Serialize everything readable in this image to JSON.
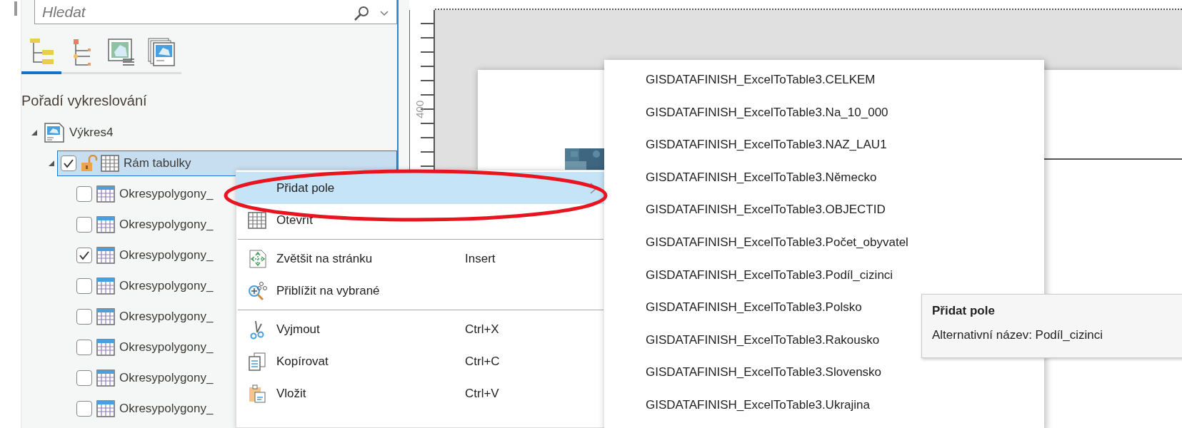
{
  "search": {
    "placeholder": "Hledat"
  },
  "view_tabs": [
    {
      "kind": "order",
      "selected": true
    },
    {
      "kind": "selection",
      "selected": false
    },
    {
      "kind": "map",
      "selected": false
    },
    {
      "kind": "maps",
      "selected": false
    }
  ],
  "heading": "Pořadí vykreslování",
  "tree": [
    {
      "label": "Výkres4",
      "kind": "layout",
      "expanded": true,
      "selected": false,
      "children": [
        {
          "label": "Rám tabulky",
          "kind": "frame",
          "expanded": true,
          "checked": true,
          "selected": true,
          "children": [
            {
              "label": "Okresypolygony_",
              "kind": "table",
              "checked": false,
              "selected": false
            },
            {
              "label": "Okresypolygony_",
              "kind": "table",
              "checked": false,
              "selected": false
            },
            {
              "label": "Okresypolygony_",
              "kind": "table",
              "checked": true,
              "selected": false
            },
            {
              "label": "Okresypolygony_",
              "kind": "table",
              "checked": false,
              "selected": false
            },
            {
              "label": "Okresypolygony_",
              "kind": "table",
              "checked": false,
              "selected": false
            },
            {
              "label": "Okresypolygony_",
              "kind": "table",
              "checked": false,
              "selected": false
            },
            {
              "label": "Okresypolygony_",
              "kind": "table",
              "checked": false,
              "selected": false
            },
            {
              "label": "Okresypolygony_",
              "kind": "table",
              "checked": false,
              "selected": false
            }
          ]
        }
      ]
    }
  ],
  "ruler": {
    "label": "400"
  },
  "context_menu": {
    "items": [
      {
        "kind": "item",
        "label": "Přidat pole",
        "submenu": true,
        "selected": true
      },
      {
        "kind": "item",
        "label": "Otevřít",
        "selected": false
      },
      {
        "kind": "separator"
      },
      {
        "kind": "item",
        "label": "Zvětšit na stránku",
        "shortcut": "Insert",
        "selected": false
      },
      {
        "kind": "item",
        "label": "Přiblížit na vybrané",
        "selected": false
      },
      {
        "kind": "separator"
      },
      {
        "kind": "item",
        "label": "Vyjmout",
        "shortcut": "Ctrl+X",
        "selected": false
      },
      {
        "kind": "item",
        "label": "Kopírovat",
        "shortcut": "Ctrl+C",
        "selected": false
      },
      {
        "kind": "item",
        "label": "Vložit",
        "shortcut": "Ctrl+V",
        "selected": false
      }
    ]
  },
  "submenu": {
    "items": [
      "GISDATAFINISH_ExcelToTable3.CELKEM",
      "GISDATAFINISH_ExcelToTable3.Na_10_000",
      "GISDATAFINISH_ExcelToTable3.NAZ_LAU1",
      "GISDATAFINISH_ExcelToTable3.Německo",
      "GISDATAFINISH_ExcelToTable3.OBJECTID",
      "GISDATAFINISH_ExcelToTable3.Počet_obyvatel",
      "GISDATAFINISH_ExcelToTable3.Podíl_cizinci",
      "GISDATAFINISH_ExcelToTable3.Polsko",
      "GISDATAFINISH_ExcelToTable3.Rakousko",
      "GISDATAFINISH_ExcelToTable3.Slovensko",
      "GISDATAFINISH_ExcelToTable3.Ukrajina"
    ]
  },
  "tooltip": {
    "title": "Přidat pole",
    "text": "Alternativní název: Podíl_cizinci"
  }
}
